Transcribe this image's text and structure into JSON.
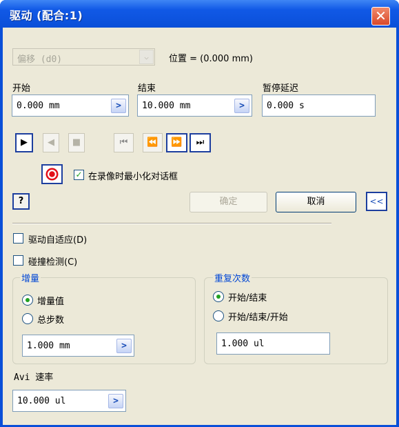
{
  "window": {
    "title": "驱动 (配合:1)",
    "close_glyph": "✕"
  },
  "top": {
    "combo_value": "偏移 (d0)",
    "position_label": "位置 = (0.000 mm)"
  },
  "fields": {
    "start": {
      "label": "开始",
      "value": "0.000 mm"
    },
    "end": {
      "label": "结束",
      "value": "10.000 mm"
    },
    "pause": {
      "label": "暂停延迟",
      "value": "0.000 s"
    }
  },
  "playback": {
    "forward": "▶",
    "reverse": "◀",
    "stop": "■",
    "to_start": "⏮",
    "step_back": "⏪",
    "step_forward": "⏩",
    "to_end": "⏭"
  },
  "record": {
    "minimize_label": "在录像时最小化对话框",
    "minimize_checked": true
  },
  "buttons": {
    "help": "?",
    "ok": "确定",
    "cancel": "取消",
    "collapse": "<<"
  },
  "options": {
    "adaptive_label": "驱动自适应(D)",
    "collision_label": "碰撞检测(C)"
  },
  "increment": {
    "title": "增量",
    "opt_value": "增量值",
    "opt_steps": "总步数",
    "value": "1.000 mm"
  },
  "repeat": {
    "title": "重复次数",
    "opt_start_end": "开始/结束",
    "opt_start_end_start": "开始/结束/开始",
    "value": "1.000 ul"
  },
  "avi": {
    "label": "Avi 速率",
    "value": "10.000 ul"
  },
  "colors": {
    "title_bar": "#0a4fd8",
    "dialog_bg": "#ece9d8",
    "group_title": "#0046d5",
    "record": "#e3101a"
  }
}
